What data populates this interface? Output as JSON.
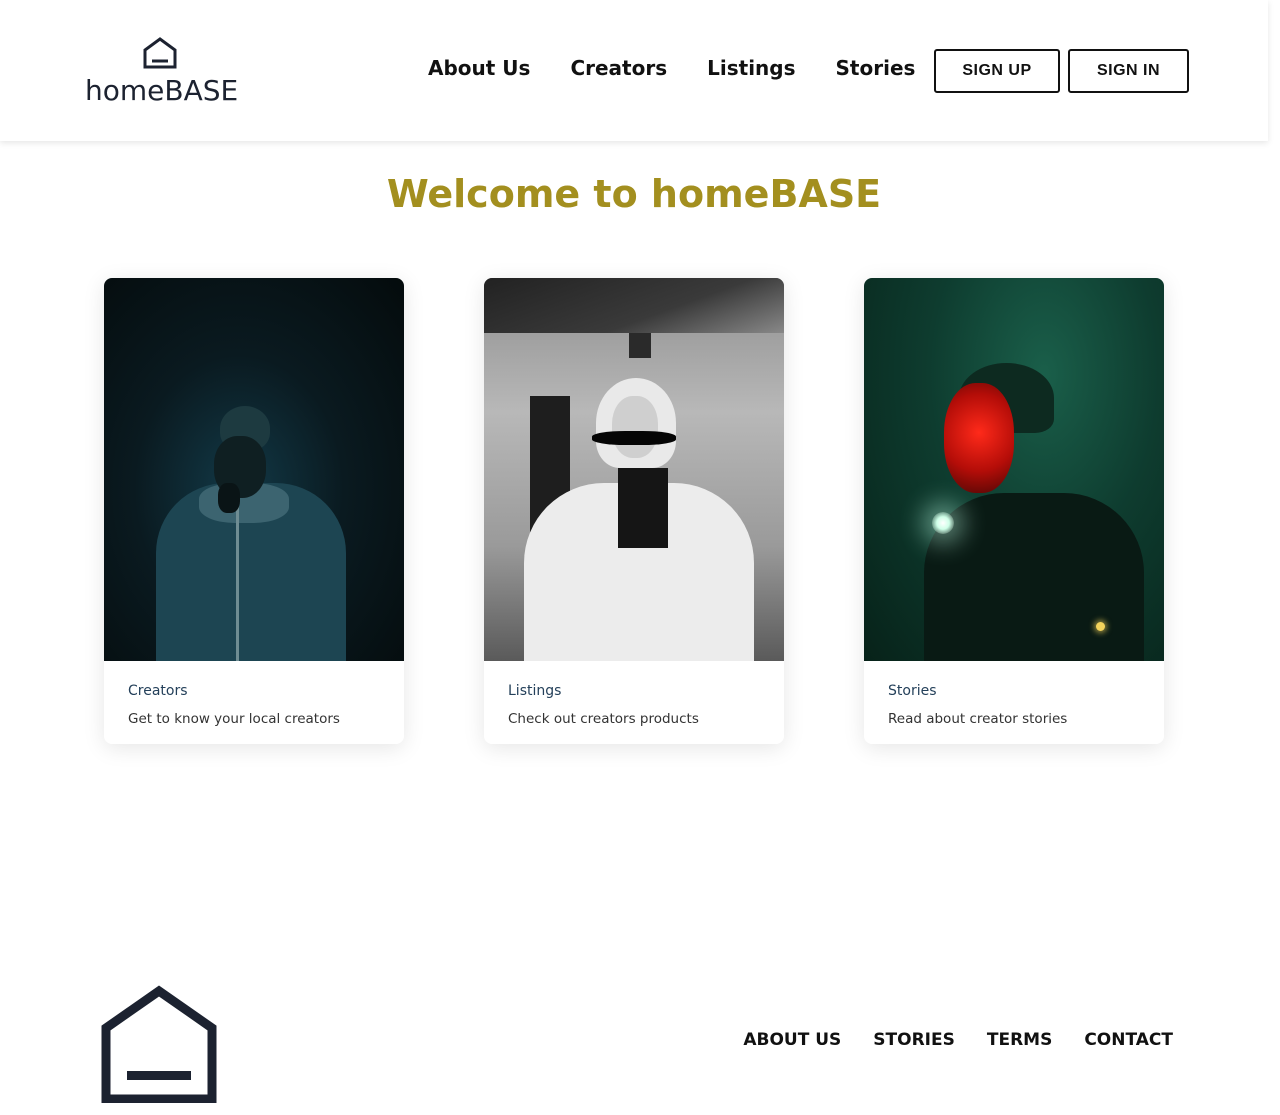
{
  "header": {
    "logo_text": "homeBASE",
    "nav": [
      "About Us",
      "Creators",
      "Listings",
      "Stories"
    ],
    "sign_up": "SIGN UP",
    "sign_in": "SIGN IN"
  },
  "hero": {
    "title": "Welcome to homeBASE"
  },
  "cards": [
    {
      "title": "Creators",
      "description": "Get to know your local creators"
    },
    {
      "title": "Listings",
      "description": "Check out creators products"
    },
    {
      "title": "Stories",
      "description": "Read about creator stories"
    }
  ],
  "footer": {
    "links": [
      "ABOUT US",
      "STORIES",
      "TERMS",
      "CONTACT"
    ]
  },
  "colors": {
    "accent": "#a38f1f",
    "logo": "#1c2230",
    "card_title": "#24405a"
  }
}
